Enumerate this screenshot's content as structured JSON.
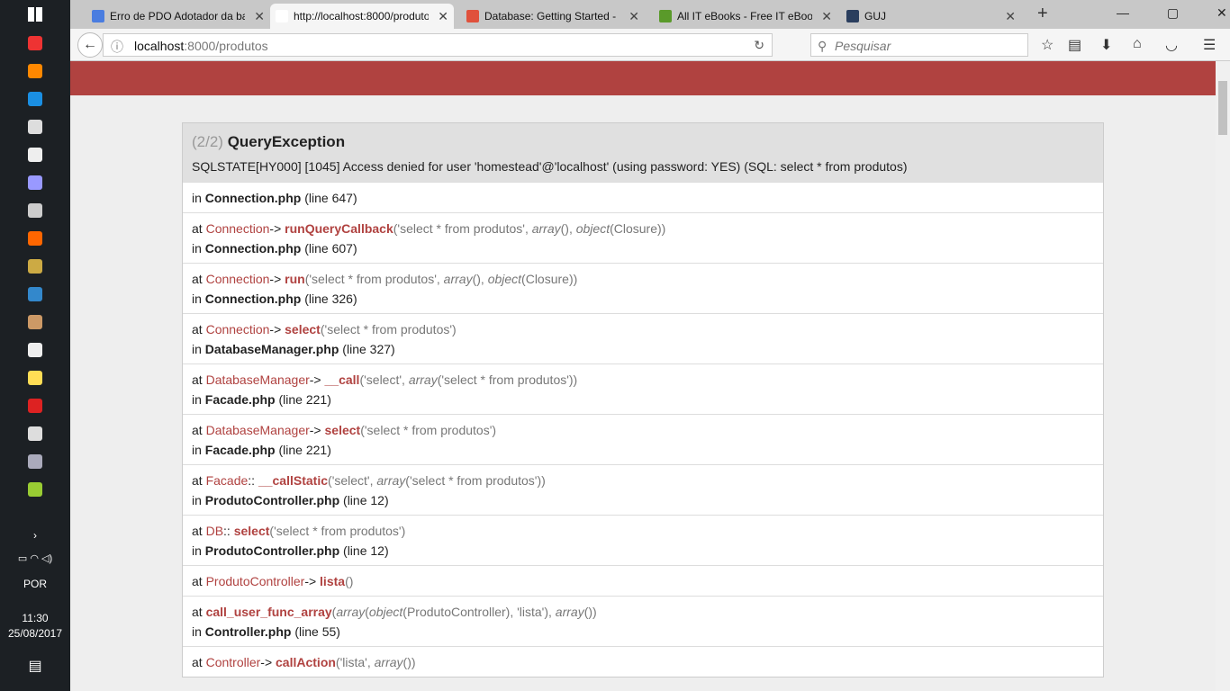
{
  "taskbar": {
    "lang": "POR",
    "time": "11:30",
    "date": "25/08/2017"
  },
  "tabs": [
    {
      "title": "Erro de PDO Adotador da ba",
      "color": "#4a7de0"
    },
    {
      "title": "http://localhost:8000/produtos",
      "color": "#fff",
      "active": true
    },
    {
      "title": "Database: Getting Started - L",
      "color": "#e0513c"
    },
    {
      "title": "All IT eBooks - Free IT eBook",
      "color": "#5a9a2a"
    },
    {
      "title": "GUJ",
      "color": "#2a3e5e"
    }
  ],
  "address": {
    "host": "localhost",
    "rest": ":8000/produtos"
  },
  "search_placeholder": "Pesquisar",
  "error": {
    "counter": "(2/2)",
    "type": "QueryException",
    "message": "SQLSTATE[HY000] [1045] Access denied for user 'homestead'@'localhost' (using password: YES) (SQL: select * from produtos)",
    "in": "in",
    "line_label": "line",
    "first": {
      "file": "Connection.php",
      "line": "647"
    },
    "frames": [
      {
        "cls": "Connection",
        "op": "->",
        "method": "runQueryCallback",
        "args": [
          [
            "'select * from produtos', ",
            0
          ],
          [
            "array",
            1
          ],
          [
            "(), ",
            0
          ],
          [
            "object",
            1
          ],
          [
            "(Closure))",
            0
          ]
        ],
        "file": "Connection.php",
        "line": "607"
      },
      {
        "cls": "Connection",
        "op": "->",
        "method": "run",
        "args": [
          [
            "'select * from produtos', ",
            0
          ],
          [
            "array",
            1
          ],
          [
            "(), ",
            0
          ],
          [
            "object",
            1
          ],
          [
            "(Closure))",
            0
          ]
        ],
        "file": "Connection.php",
        "line": "326"
      },
      {
        "cls": "Connection",
        "op": "->",
        "method": "select",
        "args": [
          [
            "'select * from produtos')",
            0
          ]
        ],
        "file": "DatabaseManager.php",
        "line": "327"
      },
      {
        "cls": "DatabaseManager",
        "op": "->",
        "method": "__call",
        "args": [
          [
            "'select', ",
            0
          ],
          [
            "array",
            1
          ],
          [
            "('select * from produtos'))",
            0
          ]
        ],
        "file": "Facade.php",
        "line": "221"
      },
      {
        "cls": "DatabaseManager",
        "op": "->",
        "method": "select",
        "args": [
          [
            "'select * from produtos')",
            0
          ]
        ],
        "file": "Facade.php",
        "line": "221"
      },
      {
        "cls": "Facade",
        "op": "::",
        "method": "__callStatic",
        "args": [
          [
            "'select', ",
            0
          ],
          [
            "array",
            1
          ],
          [
            "('select * from produtos'))",
            0
          ]
        ],
        "file": "ProdutoController.php",
        "line": "12"
      },
      {
        "cls": "DB",
        "op": "::",
        "method": "select",
        "args": [
          [
            "'select * from produtos')",
            0
          ]
        ],
        "file": "ProdutoController.php",
        "line": "12"
      },
      {
        "cls": "ProdutoController",
        "op": "->",
        "method": "lista",
        "args": [
          [
            ")",
            0
          ]
        ]
      },
      {
        "cls": "",
        "op": "",
        "method": "call_user_func_array",
        "args": [
          [
            "array",
            1
          ],
          [
            "(",
            0
          ],
          [
            "object",
            1
          ],
          [
            "(ProdutoController), 'lista'), ",
            0
          ],
          [
            "array",
            1
          ],
          [
            "())",
            0
          ]
        ],
        "file": "Controller.php",
        "line": "55"
      },
      {
        "cls": "Controller",
        "op": "->",
        "method": "callAction",
        "args": [
          [
            "'lista', ",
            0
          ],
          [
            "array",
            1
          ],
          [
            "())",
            0
          ]
        ]
      }
    ]
  }
}
